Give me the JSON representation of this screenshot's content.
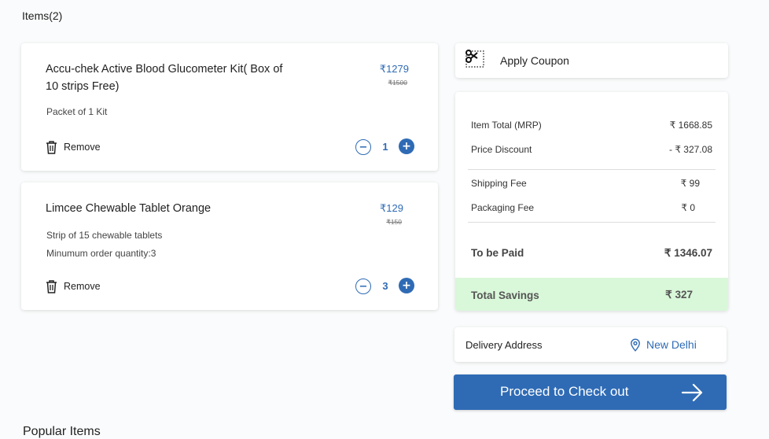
{
  "items_heading": "Items(2)",
  "items": [
    {
      "name_line1": "Accu-chek Active Blood Glucometer Kit( Box of",
      "name_line2": "10 strips Free)",
      "details": [
        "Packet of 1 Kit"
      ],
      "price": "₹1279",
      "mrp": "₹1500",
      "remove_label": "Remove",
      "quantity": "1"
    },
    {
      "name_line1": "Limcee Chewable Tablet Orange",
      "name_line2": "",
      "details": [
        "Strip of 15 chewable tablets",
        "Minumum order quantity:3"
      ],
      "price": "₹129",
      "mrp": "₹150",
      "remove_label": "Remove",
      "quantity": "3"
    }
  ],
  "coupon": {
    "label": "Apply Coupon",
    "icon": "scissors-coupon-icon"
  },
  "summary": {
    "item_total_label": "Item Total (MRP)",
    "item_total_value": "₹ 1668.85",
    "discount_label": "Price Discount",
    "discount_value": "- ₹ 327.08",
    "shipping_label": "Shipping Fee",
    "shipping_value": "₹ 99",
    "packaging_label": "Packaging Fee",
    "packaging_value": "₹ 0",
    "to_be_paid_label": "To be Paid",
    "to_be_paid_value": "₹ 1346.07",
    "savings_label": "Total Savings",
    "savings_value": "₹ 327"
  },
  "delivery": {
    "label": "Delivery Address",
    "city": "New Delhi",
    "icon": "location-pin-icon"
  },
  "checkout": {
    "label": "Proceed to Check out",
    "icon": "arrow-right-icon"
  },
  "popular_heading": "Popular Items",
  "colors": {
    "accent": "#2f6bb5",
    "savings_bg": "#d9f7d9"
  }
}
